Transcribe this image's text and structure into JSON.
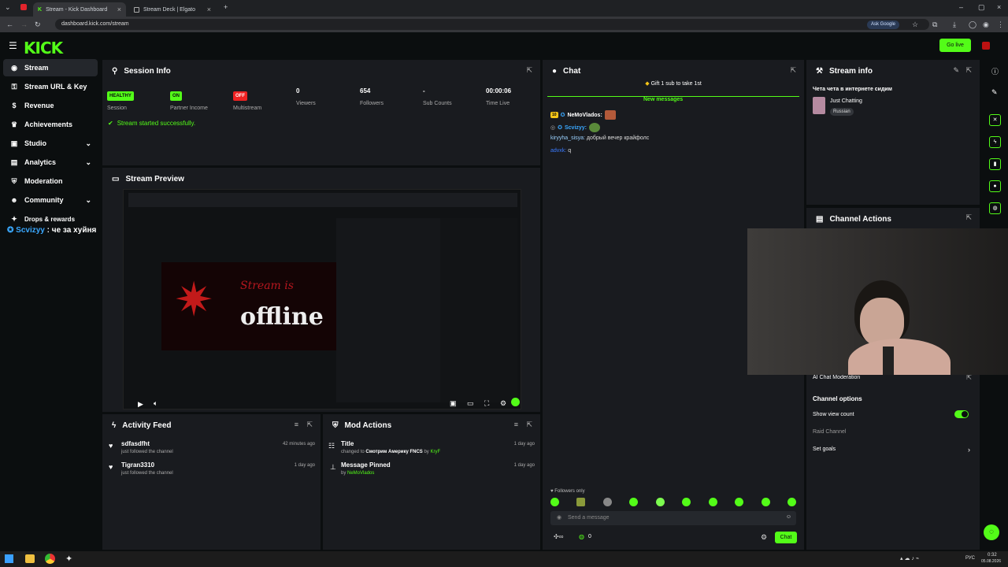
{
  "browser": {
    "tabs": [
      {
        "title": "Stream - Kick Dashboard",
        "active": true
      },
      {
        "title": "Stream Deck | Elgato",
        "active": false
      }
    ],
    "url": "dashboard.kick.com/stream",
    "ask_google": "Ask Google"
  },
  "header": {
    "logo": "KICK",
    "go_live": "Go live"
  },
  "sidebar": {
    "items": [
      {
        "label": "Stream",
        "icon": "broadcast-icon"
      },
      {
        "label": "Stream URL & Key",
        "icon": "key-icon"
      },
      {
        "label": "Revenue",
        "icon": "dollar-icon"
      },
      {
        "label": "Achievements",
        "icon": "trophy-icon"
      },
      {
        "label": "Studio",
        "icon": "studio-icon"
      },
      {
        "label": "Analytics",
        "icon": "chart-icon"
      },
      {
        "label": "Moderation",
        "icon": "shield-icon"
      },
      {
        "label": "Community",
        "icon": "people-icon"
      },
      {
        "label": "Drops & rewards",
        "icon": "gift-icon"
      }
    ],
    "overlay_user": "Scvizyy",
    "overlay_text": ": че за хуйня"
  },
  "session": {
    "title": "Session Info",
    "stats": [
      {
        "value": "HEALTHY",
        "label": "Session"
      },
      {
        "value": "ON",
        "label": "Partner Income"
      },
      {
        "value": "OFF",
        "label": "Multistream"
      },
      {
        "value": "0",
        "label": "Viewers"
      },
      {
        "value": "654",
        "label": "Followers"
      },
      {
        "value": "-",
        "label": "Sub Counts"
      },
      {
        "value": "00:00:06",
        "label": "Time Live"
      }
    ],
    "message": "Stream started successfully."
  },
  "preview": {
    "title": "Stream Preview",
    "offline_text_1": "Stream is",
    "offline_text_2": "offline"
  },
  "activity": {
    "title": "Activity Feed",
    "items": [
      {
        "name": "sdfasdfht",
        "sub": "just followed the channel",
        "time": "42 minutes ago"
      },
      {
        "name": "Tigran3310",
        "sub": "just followed the channel",
        "time": "1 day ago"
      }
    ]
  },
  "mod_actions": {
    "title": "Mod Actions",
    "items": [
      {
        "name": "Title",
        "sub_prefix": "changed to",
        "sub_value": "Смотрим Америку FNCS",
        "by": "by",
        "user": "KryF",
        "time": "1 day ago"
      },
      {
        "name": "Message Pinned",
        "by": "by",
        "user": "NeMoVlados",
        "time": "1 day ago"
      }
    ]
  },
  "chat": {
    "title": "Chat",
    "gift": "Gift 1 sub to take 1st",
    "new_messages": "New messages",
    "messages": [
      {
        "user": "NeMoVlados:",
        "text": "",
        "badge": "10"
      },
      {
        "user": "Scvizyy:",
        "text": ""
      },
      {
        "user": "kiryyha_sisya:",
        "text": "добрый вечер крайфолс"
      },
      {
        "user": "advxk:",
        "text": "q"
      }
    ],
    "followers_only": "Followers only",
    "placeholder": "Send a message",
    "count": "0",
    "send": "Chat"
  },
  "stream_info": {
    "title": "Stream info",
    "stream_title": "Чета чета в интернете сидим",
    "category": "Just Chatting",
    "tag": "Russian"
  },
  "channel_actions": {
    "title": "Channel Actions",
    "ai_mod": "AI Chat Moderation",
    "options_title": "Channel options",
    "show_view_count": "Show view count",
    "raid": "Raid Channel",
    "set_goals": "Set goals"
  },
  "taskbar": {
    "time": "0:32",
    "date": "05.08.2026",
    "lang": "РУС"
  },
  "colors": {
    "accent": "#53fc18",
    "panel": "#191b1f",
    "bg": "#0b0e0f"
  }
}
